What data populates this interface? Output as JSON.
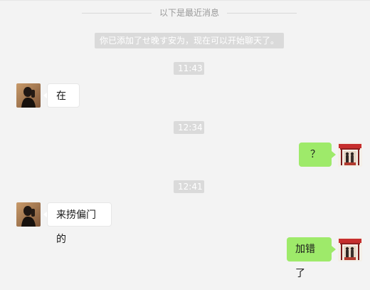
{
  "history_divider": {
    "label": "以下是最近消息"
  },
  "system_message": {
    "text": "你已添加了せ晚す安为，现在可以开始聊天了。"
  },
  "timestamps": [
    "11:43",
    "12:34",
    "12:41"
  ],
  "messages": [
    {
      "text": "在"
    },
    {
      "text": "？"
    },
    {
      "text": "来捞偏门的"
    },
    {
      "text": "加错了"
    }
  ],
  "colors": {
    "background": "#f3f3f3",
    "incoming_bubble": "#ffffff",
    "outgoing_bubble": "#9eea6a",
    "chip": "#dadada"
  },
  "icons": {
    "contact_avatar": "contact-avatar-icon",
    "self_avatar": "self-avatar-icon"
  }
}
